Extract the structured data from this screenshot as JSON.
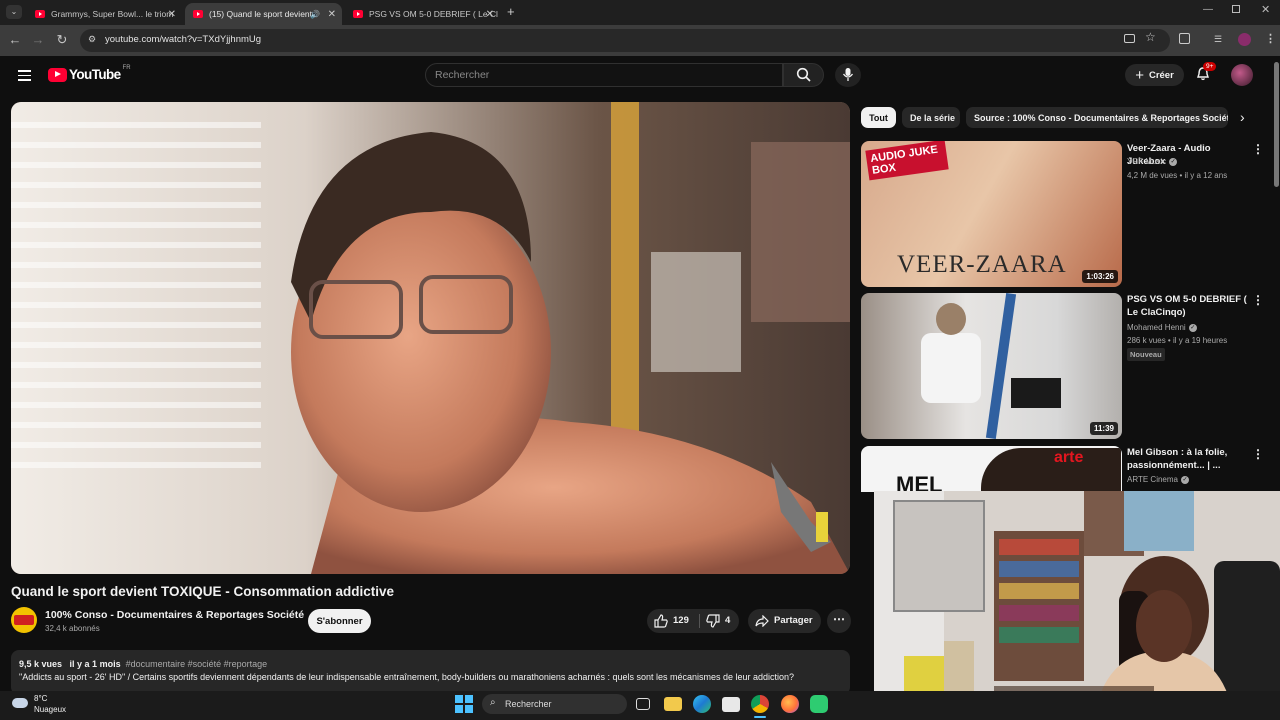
{
  "browser": {
    "tabs": [
      {
        "title": "Grammys, Super Bowl... le triom",
        "active": false
      },
      {
        "title": "(15) Quand le sport devient",
        "active": true
      },
      {
        "title": "PSG VS OM 5-0 DEBRIEF ( Le Cl",
        "active": false
      }
    ],
    "url": "youtube.com/watch?v=TXdYjjhnmUg"
  },
  "youtube": {
    "logo_text": "YouTube",
    "region": "FR",
    "search_placeholder": "Rechercher",
    "create_label": "Créer",
    "notifications_badge": "9+"
  },
  "video": {
    "title": "Quand le sport devient TOXIQUE - Consommation addictive",
    "channel": "100% Conso - Documentaires & Reportages Société",
    "subscribers": "32,4 k abonnés",
    "subscribe_label": "S'abonner",
    "likes": "129",
    "dislikes": "4",
    "share_label": "Partager",
    "views": "9,5 k vues",
    "age": "il y a 1 mois",
    "tags": "#documentaire #société #reportage",
    "description": "\"Addicts au sport - 26' HD\" / Certains sportifs deviennent dépendants de leur indispensable entraînement, body-builders ou marathoniens acharnés : quels sont les mécanismes de leur addiction?"
  },
  "chips": [
    "Tout",
    "De la série",
    "Source : 100% Conso - Documentaires & Reportages Société"
  ],
  "recommendations": [
    {
      "title": "Veer-Zaara - Audio Jukebox",
      "channel": "YRF Music",
      "meta": "4,2 M de vues • il y a 12 ans",
      "duration": "1:03:26",
      "thumb_text": "VEER-ZAARA",
      "thumb_tag": "AUDIO JUKE BOX"
    },
    {
      "title": "PSG VS OM 5-0 DEBRIEF ( Le ClaCinqo)",
      "channel": "Mohamed Henni",
      "meta": "286 k vues • il y a 19 heures",
      "badge": "Nouveau",
      "duration": "11:39"
    },
    {
      "title": "Mel Gibson : à la folie, passionnément... | ...",
      "channel": "ARTE Cinema",
      "thumb_text": "MEL",
      "thumb_tag": "arte"
    }
  ],
  "taskbar": {
    "weather_temp": "8°C",
    "weather_desc": "Nuageux",
    "search_label": "Rechercher"
  }
}
